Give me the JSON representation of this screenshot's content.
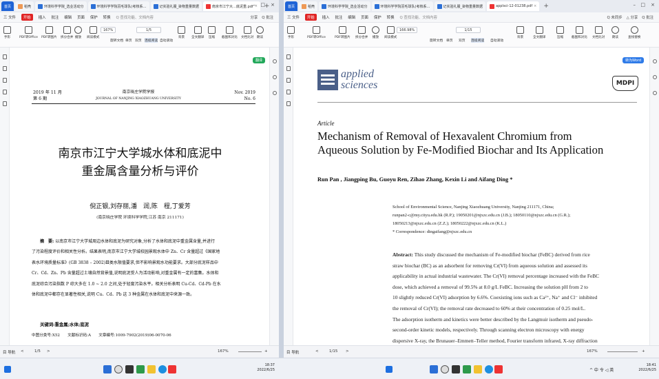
{
  "left_window": {
    "tabs": [
      {
        "label": "首页",
        "home": true
      },
      {
        "label": "稻壳"
      },
      {
        "label": "环境科学学院_选业活动分"
      },
      {
        "label": "环境科学学院羽毛球队(考核系…"
      },
      {
        "label": "记实验礼服_染物重量数据"
      },
      {
        "label": "南京市江宁大…底泥重.pdf",
        "active": true
      }
    ],
    "menu": {
      "file": "三 文件",
      "items": [
        "开始",
        "插入",
        "批注",
        "编辑",
        "页面",
        "保护",
        "转换"
      ],
      "search": "Q 查找功能、文档内容",
      "right": [
        "分享",
        "Q 批注"
      ]
    },
    "toolbar": {
      "zoom": "167%",
      "page": "1/5",
      "buttons": [
        "手形",
        "选择",
        "PDF转Office",
        "PDF转图片",
        "拆分合并",
        "播放",
        "阅读模式",
        "旋转文档",
        "单页",
        "双页",
        "连续阅读",
        "自动滚动",
        "背景",
        "全文翻译",
        "压缩",
        "截图和对比",
        "文档比对",
        "朗读",
        "查找替换"
      ]
    },
    "badge": "翻译",
    "doc": {
      "header_left_1": "2019 年 11 月",
      "header_left_2": "第 6 期",
      "header_center_1": "南京晓庄学院学报",
      "header_center_2": "JOURNAL OF NANJING XIAOZHUANG UNIVERSITY",
      "header_right_1": "Nov. 2019",
      "header_right_2": "No. 6",
      "title_1": "南京市江宁大学城水体和底泥中",
      "title_2": "重金属含量分析与评价",
      "authors": "倪正银,刘存丽,潘　润,陈　程,丁爱芳",
      "affiliation": "(南京晓庄学院 环境科学学院,江苏 南京 211171)",
      "abstract_label": "摘　要:",
      "abstract_lines": [
        "以南京市江宁大学城周边水体和底泥为研究对象,分析了水体和底泥中重金属含量,并进行",
        "了污染程度评价和相关性分析。结果表明,南京市江宁大学城校园景观水体中 Zn、Cr 含量超过《国家地",
        "表水环境质量标准》(GB 3838 – 2002)Ⅲ类水限值要求,但不影响景观水功能要求。大部分底泥样品中",
        "Cr、Cd、Zn、Pb 含量超过土壤自然背景值,说明底泥受人为活动影响,对重金属有一定的富集。水体和",
        "底泥综合污染指数 P 综大多在 1.0 ~ 2.0 之间,处于轻度污染水平。相关分析表明 Cu-Cd、Cd-Pb 在水",
        "体和底泥中都存在显著性相关,说明 Cu、Cd、Pb 这 3 种金属在水体和底泥中来源一致。"
      ],
      "keywords": "关键词:重金属;水体;底泥",
      "cut_line": "中图分类号:X52　　文献标识码:A　　文章编号:1009-7902(2019)06-0070-06"
    },
    "status": {
      "nav": "目 导航",
      "prev": "<",
      "page": "1/5",
      "next": ">",
      "zoom": "167%"
    }
  },
  "right_window": {
    "tabs": [
      {
        "label": "首页",
        "home": true
      },
      {
        "label": "稻壳"
      },
      {
        "label": "环境科学学院_选业活动分"
      },
      {
        "label": "环境科学学院羽毛球队(考核系…"
      },
      {
        "label": "记实验礼服_染物重量数据"
      },
      {
        "label": "applsci-12-01238.pdf",
        "active": true
      }
    ],
    "menu": {
      "file": "三 文件",
      "items": [
        "开始",
        "插入",
        "批注",
        "编辑",
        "页面",
        "保护",
        "转换"
      ],
      "search": "Q 查找功能、文档内容",
      "right": [
        "Q 未同步",
        "△ 分享",
        "Q 批注"
      ]
    },
    "toolbar": {
      "zoom": "166.98%",
      "page": "1/15",
      "buttons": [
        "手形",
        "选择",
        "PDF转Office",
        "PDF转图片",
        "拆分合并",
        "播放",
        "阅读模式",
        "旋转文档",
        "单页",
        "双页",
        "连续阅读",
        "自动滚动",
        "背景",
        "全文翻译",
        "压缩",
        "截图和对比",
        "文档比对",
        "朗读",
        "查找替换"
      ]
    },
    "badge": "转为Word",
    "doc": {
      "journal_1": "applied",
      "journal_2": "sciences",
      "publisher": "MDPI",
      "article_type": "Article",
      "title_1": "Mechanism of Removal of Hexavalent Chromium from",
      "title_2": "Aqueous Solution by Fe-Modified Biochar and Its Application",
      "authors": "Run Pan , Jiangping Bu, Guoyu Ren, Zihao Zhang, Kexin Li and Aifang Ding *",
      "affil_lines": [
        "School of Environmental Science, Nanjing Xiaozhuang University, Nanjing 211171, China;",
        "runpan2-c@my.cityu.edu.hk (R.P.); 19050201@njxzc.edu.cn (J.B.); 18050110@njxzc.edu.cn (G.R.);",
        "18050213@njxzc.edu.cn (Z.Z.); 18050222@njxzc.edu.cn (K.L.)",
        "* Correspondence: dingaifang@njxzc.edu.cn"
      ],
      "abstract_label": "Abstract:",
      "abstract_lines": [
        "This study discussed the mechanism of Fe-modified biochar (FeBC) derived from rice",
        "straw biochar (BC) as an adsorbent for removing Cr(VI) from aqueous solution and assessed its",
        "applicability in actual industrial wastewater. The Cr(VI) removal percentage increased with the FeBC",
        "dose, which achieved a removal of 99.5% at 8.0 g/L FeBC. Increasing the solution pH from 2 to",
        "10 slightly reduced Cr(VI) adsorption by 6.6%. Coexisting ions such as Ca²⁺, Na⁺ and Cl⁻ inhibited",
        "the removal of Cr(VI); the removal rate decreased to 60% at their concentration of 0.25 mol/L.",
        "The adsorption isotherm and kinetics were better described by the Langmuir isotherm and pseudo-",
        "second-order kinetic models, respectively.  Through scanning electron microscopy with energy",
        "dispersive X-ray, the Brunauer–Emmett–Teller method, Fourier transform infrared, X-ray diffraction"
      ]
    },
    "status": {
      "nav": "目 导航",
      "prev": "<",
      "page": "1/15",
      "next": ">",
      "zoom": "167%"
    }
  },
  "taskbar": {
    "time": "18:41",
    "date": "2022/6/25",
    "tray": "^ 中 令 ◁ 英",
    "time_left": "18:37",
    "date_left": "2022/6/25"
  }
}
